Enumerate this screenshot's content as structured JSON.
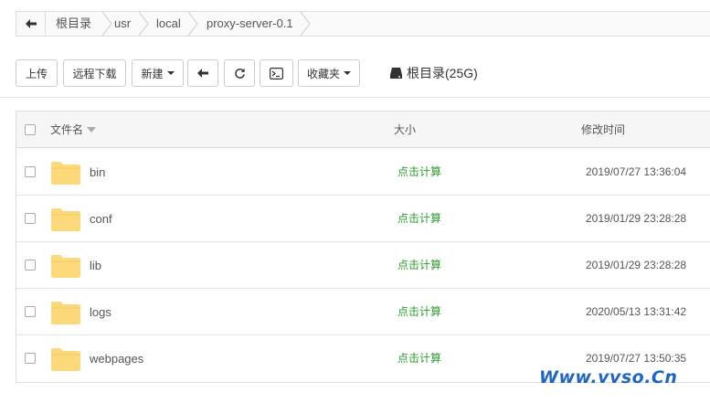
{
  "breadcrumb": {
    "items": [
      "根目录",
      "usr",
      "local",
      "proxy-server-0.1"
    ]
  },
  "toolbar": {
    "upload_label": "上传",
    "remote_download_label": "远程下载",
    "new_label": "新建",
    "favorites_label": "收藏夹",
    "disk_label": "根目录(25G)"
  },
  "table": {
    "headers": {
      "name": "文件名",
      "size": "大小",
      "modified": "修改时间"
    },
    "rows": [
      {
        "name": "bin",
        "size": "点击计算",
        "modified": "2019/07/27 13:36:04"
      },
      {
        "name": "conf",
        "size": "点击计算",
        "modified": "2019/01/29 23:28:28"
      },
      {
        "name": "lib",
        "size": "点击计算",
        "modified": "2019/01/29 23:28:28"
      },
      {
        "name": "logs",
        "size": "点击计算",
        "modified": "2020/05/13 13:31:42"
      },
      {
        "name": "webpages",
        "size": "点击计算",
        "modified": "2019/07/27 13:50:35"
      }
    ]
  },
  "watermark": "Www.vvso.Cn",
  "colors": {
    "folder": "#fcd97a",
    "size_link": "#2d9e2d",
    "watermark": "#1f66c2"
  }
}
